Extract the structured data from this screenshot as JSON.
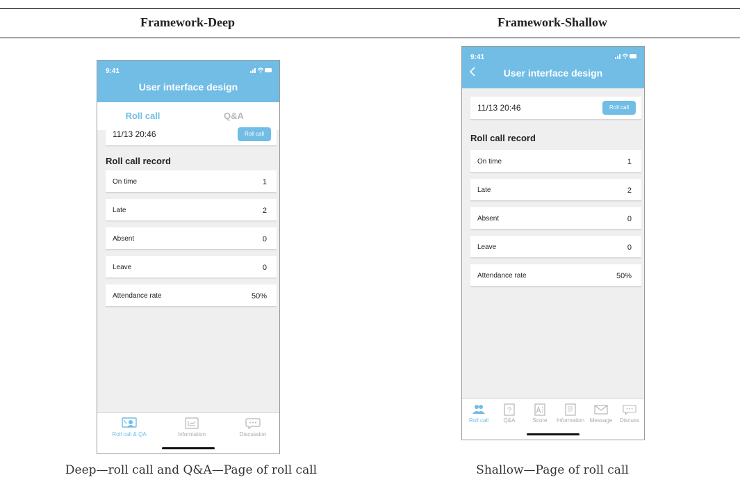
{
  "columns": {
    "left_heading": "Framework-Deep",
    "right_heading": "Framework-Shallow",
    "left_caption": "Deep—roll call and Q&A—Page of roll call",
    "right_caption": "Shallow—Page of roll call"
  },
  "colors": {
    "accent": "#71bde6",
    "background": "#efefef",
    "card": "#ffffff"
  },
  "deep": {
    "status_time": "9:41",
    "title": "User interface design",
    "tabs": [
      {
        "label": "Roll call",
        "active": true
      },
      {
        "label": "Q&A",
        "active": false
      }
    ],
    "date_card": {
      "date": "11/13 20:46",
      "button": "Roll call"
    },
    "record_title": "Roll call record",
    "records": [
      {
        "label": "On time",
        "value": "1"
      },
      {
        "label": "Late",
        "value": "2"
      },
      {
        "label": "Absent",
        "value": "0"
      },
      {
        "label": "Leave",
        "value": "0"
      },
      {
        "label": "Attendance rate",
        "value": "50%"
      }
    ],
    "nav": [
      {
        "label": "Roll call & QA",
        "icon": "roll-call-qa-icon",
        "active": true
      },
      {
        "label": "Information",
        "icon": "information-icon",
        "active": false
      },
      {
        "label": "Discussion",
        "icon": "discussion-icon",
        "active": false
      }
    ]
  },
  "shallow": {
    "status_time": "9:41",
    "back_icon": "chevron-left-icon",
    "title": "User interface design",
    "date_card": {
      "date": "11/13 20:46",
      "button": "Roll call"
    },
    "record_title": "Roll call record",
    "records": [
      {
        "label": "On time",
        "value": "1"
      },
      {
        "label": "Late",
        "value": "2"
      },
      {
        "label": "Absent",
        "value": "0"
      },
      {
        "label": "Leave",
        "value": "0"
      },
      {
        "label": "Attendance rate",
        "value": "50%"
      }
    ],
    "nav": [
      {
        "label": "Roll call",
        "icon": "roll-call-icon",
        "active": true
      },
      {
        "label": "Q&A",
        "icon": "question-icon",
        "active": false
      },
      {
        "label": "Score",
        "icon": "score-icon",
        "active": false
      },
      {
        "label": "Information",
        "icon": "information-icon",
        "active": false
      },
      {
        "label": "Message",
        "icon": "message-icon",
        "active": false
      },
      {
        "label": "Discuss",
        "icon": "discussion-icon",
        "active": false
      }
    ]
  }
}
